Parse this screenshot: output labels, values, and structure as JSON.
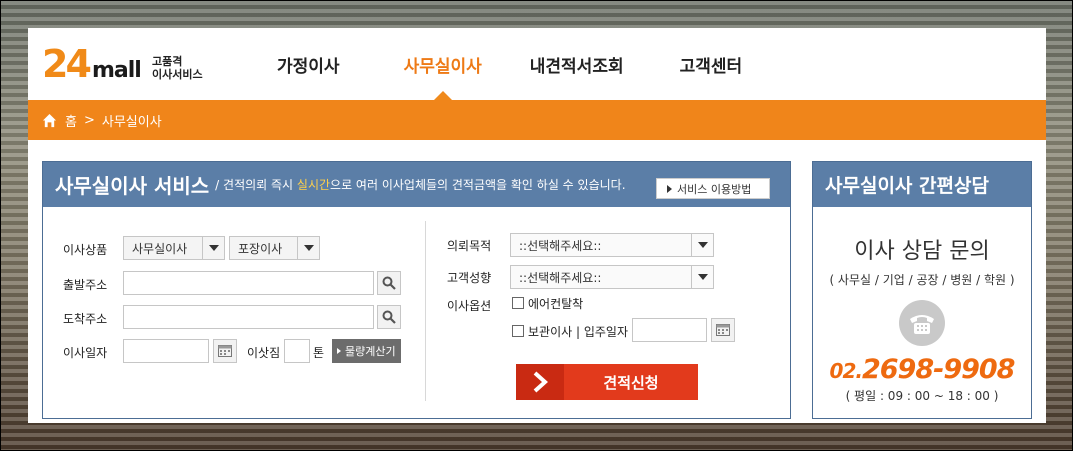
{
  "logo": {
    "num": "24",
    "mall": "mall",
    "tag_line1": "고품격",
    "tag_line2": "이사서비스"
  },
  "nav": {
    "items": [
      {
        "label": "가정이사"
      },
      {
        "label": "사무실이사"
      },
      {
        "label": "내견적서조회"
      },
      {
        "label": "고객센터"
      }
    ]
  },
  "breadcrumb": {
    "home": "홈",
    "separator": ">",
    "current": "사무실이사"
  },
  "panel": {
    "title": "사무실이사 서비스",
    "desc_pre": "/ 견적의뢰 즉시 ",
    "desc_highlight": "실시간",
    "desc_post": "으로 여러 이사업체들의 견적금액을 확인 하실 수 있습니다.",
    "guide_button": "서비스 이용방법"
  },
  "form": {
    "product_label": "이사상품",
    "product_value": "사무실이사",
    "packing_value": "포장이사",
    "origin_label": "출발주소",
    "dest_label": "도착주소",
    "date_label": "이사일자",
    "load_label": "이삿짐",
    "load_unit": "톤",
    "calc_button": "물량계산기",
    "purpose_label": "의뢰목적",
    "purpose_value": "::선택해주세요::",
    "tendency_label": "고객성향",
    "tendency_value": "::선택해주세요::",
    "option_label": "이사옵션",
    "option_aircon": "에어컨탈착",
    "option_storage": "보관이사 | 입주일자",
    "submit_label": "견적신청"
  },
  "side": {
    "title": "사무실이사 간편상담",
    "question": "이사 상담 문의",
    "categories": "( 사무실 / 기업 / 공장 / 병원 / 학원 )",
    "tel_prefix": "02.",
    "tel_number": "2698-9908",
    "hours": "( 평일 : 09 : 00 ~ 18 : 00 )"
  },
  "colors": {
    "accent": "#f0851a",
    "panel": "#5b7ea7",
    "submit": "#e23a1c"
  }
}
